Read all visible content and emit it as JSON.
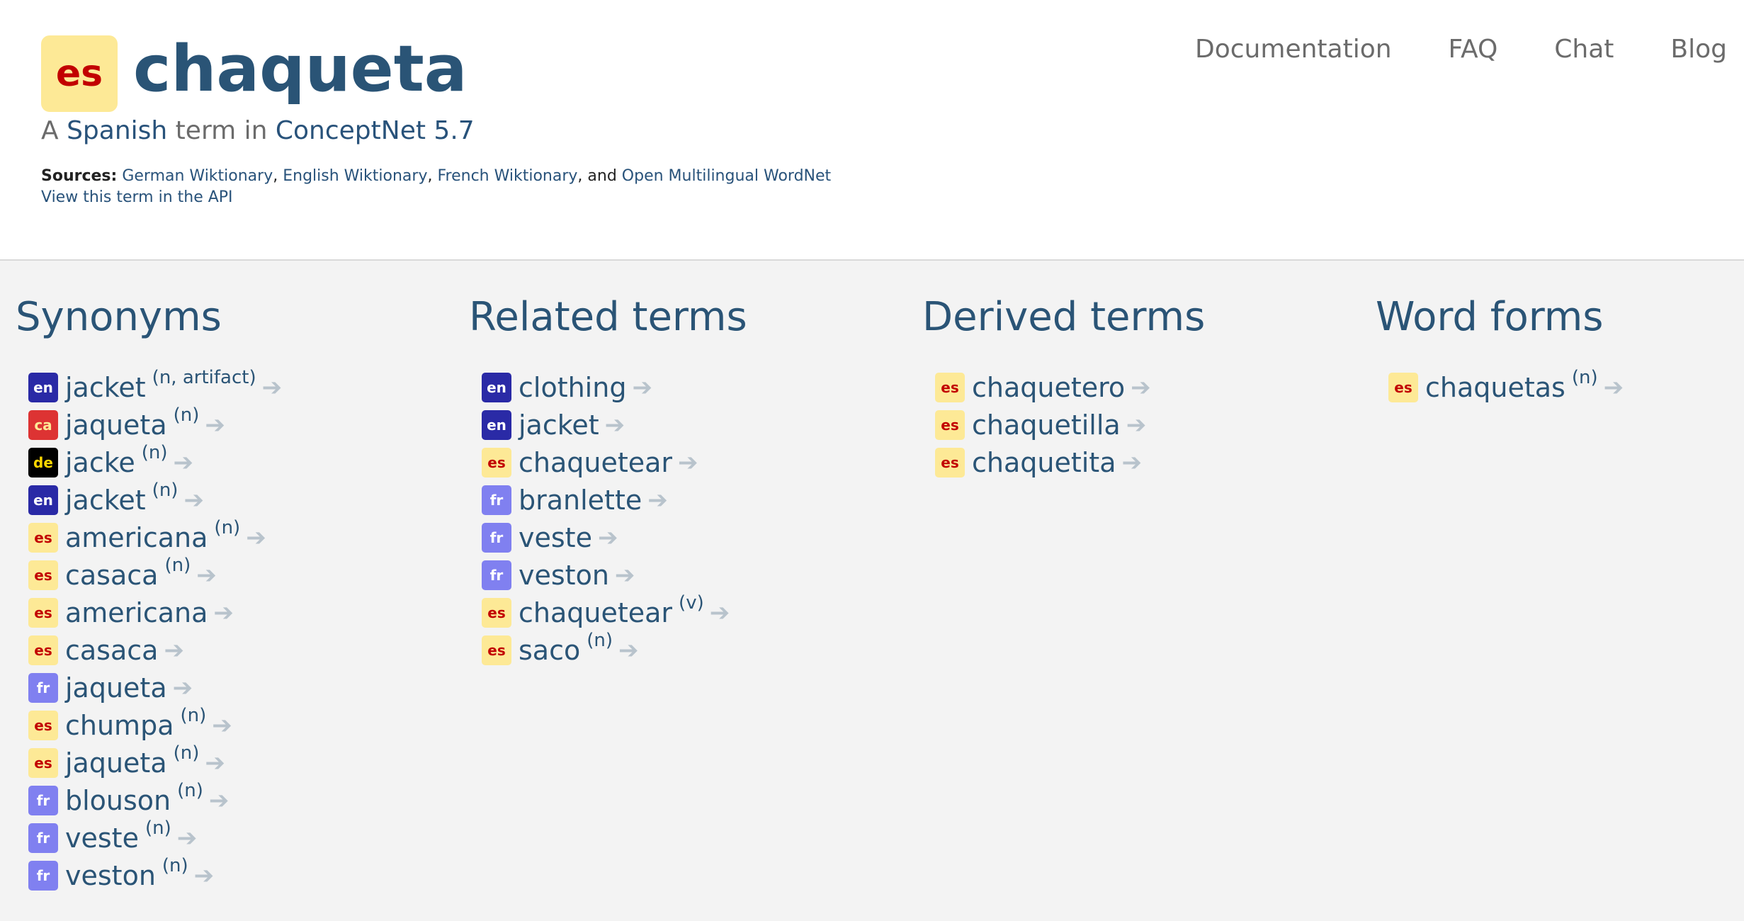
{
  "header": {
    "lang_code": "es",
    "term": "chaqueta",
    "subtitle_prefix": "A ",
    "language_link": "Spanish",
    "subtitle_middle": " term in ",
    "project_link": "ConceptNet 5.7",
    "sources_label": "Sources:",
    "sources": [
      "German Wiktionary",
      "English Wiktionary",
      "French Wiktionary",
      "Open Multilingual WordNet"
    ],
    "sources_sep1": ", ",
    "sources_sep2": ", ",
    "sources_sep3": ", and ",
    "api_link": "View this term in the API"
  },
  "nav": {
    "documentation": "Documentation",
    "faq": "FAQ",
    "chat": "Chat",
    "blog": "Blog"
  },
  "arrow_glyph": "➔",
  "colors": {
    "term_blue": "#2a5476",
    "badge_en": "#2a2aa6",
    "badge_ca": "#dd3333",
    "badge_de": "#000000",
    "badge_fr": "#8080f0",
    "badge_es": "#fde996",
    "page_bg": "#f3f3f3"
  },
  "sections": [
    {
      "title": "Synonyms",
      "items": [
        {
          "lang": "en",
          "word": "jacket",
          "pos": "(n, artifact)"
        },
        {
          "lang": "ca",
          "word": "jaqueta",
          "pos": "(n)"
        },
        {
          "lang": "de",
          "word": "jacke",
          "pos": "(n)"
        },
        {
          "lang": "en",
          "word": "jacket",
          "pos": "(n)"
        },
        {
          "lang": "es",
          "word": "americana",
          "pos": "(n)"
        },
        {
          "lang": "es",
          "word": "casaca",
          "pos": "(n)"
        },
        {
          "lang": "es",
          "word": "americana",
          "pos": ""
        },
        {
          "lang": "es",
          "word": "casaca",
          "pos": ""
        },
        {
          "lang": "fr",
          "word": "jaqueta",
          "pos": ""
        },
        {
          "lang": "es",
          "word": "chumpa",
          "pos": "(n)"
        },
        {
          "lang": "es",
          "word": "jaqueta",
          "pos": "(n)"
        },
        {
          "lang": "fr",
          "word": "blouson",
          "pos": "(n)"
        },
        {
          "lang": "fr",
          "word": "veste",
          "pos": "(n)"
        },
        {
          "lang": "fr",
          "word": "veston",
          "pos": "(n)"
        }
      ]
    },
    {
      "title": "Related terms",
      "items": [
        {
          "lang": "en",
          "word": "clothing",
          "pos": ""
        },
        {
          "lang": "en",
          "word": "jacket",
          "pos": ""
        },
        {
          "lang": "es",
          "word": "chaquetear",
          "pos": ""
        },
        {
          "lang": "fr",
          "word": "branlette",
          "pos": ""
        },
        {
          "lang": "fr",
          "word": "veste",
          "pos": ""
        },
        {
          "lang": "fr",
          "word": "veston",
          "pos": ""
        },
        {
          "lang": "es",
          "word": "chaquetear",
          "pos": "(v)"
        },
        {
          "lang": "es",
          "word": "saco",
          "pos": "(n)"
        }
      ]
    },
    {
      "title": "Derived terms",
      "items": [
        {
          "lang": "es",
          "word": "chaquetero",
          "pos": ""
        },
        {
          "lang": "es",
          "word": "chaquetilla",
          "pos": ""
        },
        {
          "lang": "es",
          "word": "chaquetita",
          "pos": ""
        }
      ]
    },
    {
      "title": "Word forms",
      "items": [
        {
          "lang": "es",
          "word": "chaquetas",
          "pos": "(n)"
        }
      ]
    }
  ]
}
